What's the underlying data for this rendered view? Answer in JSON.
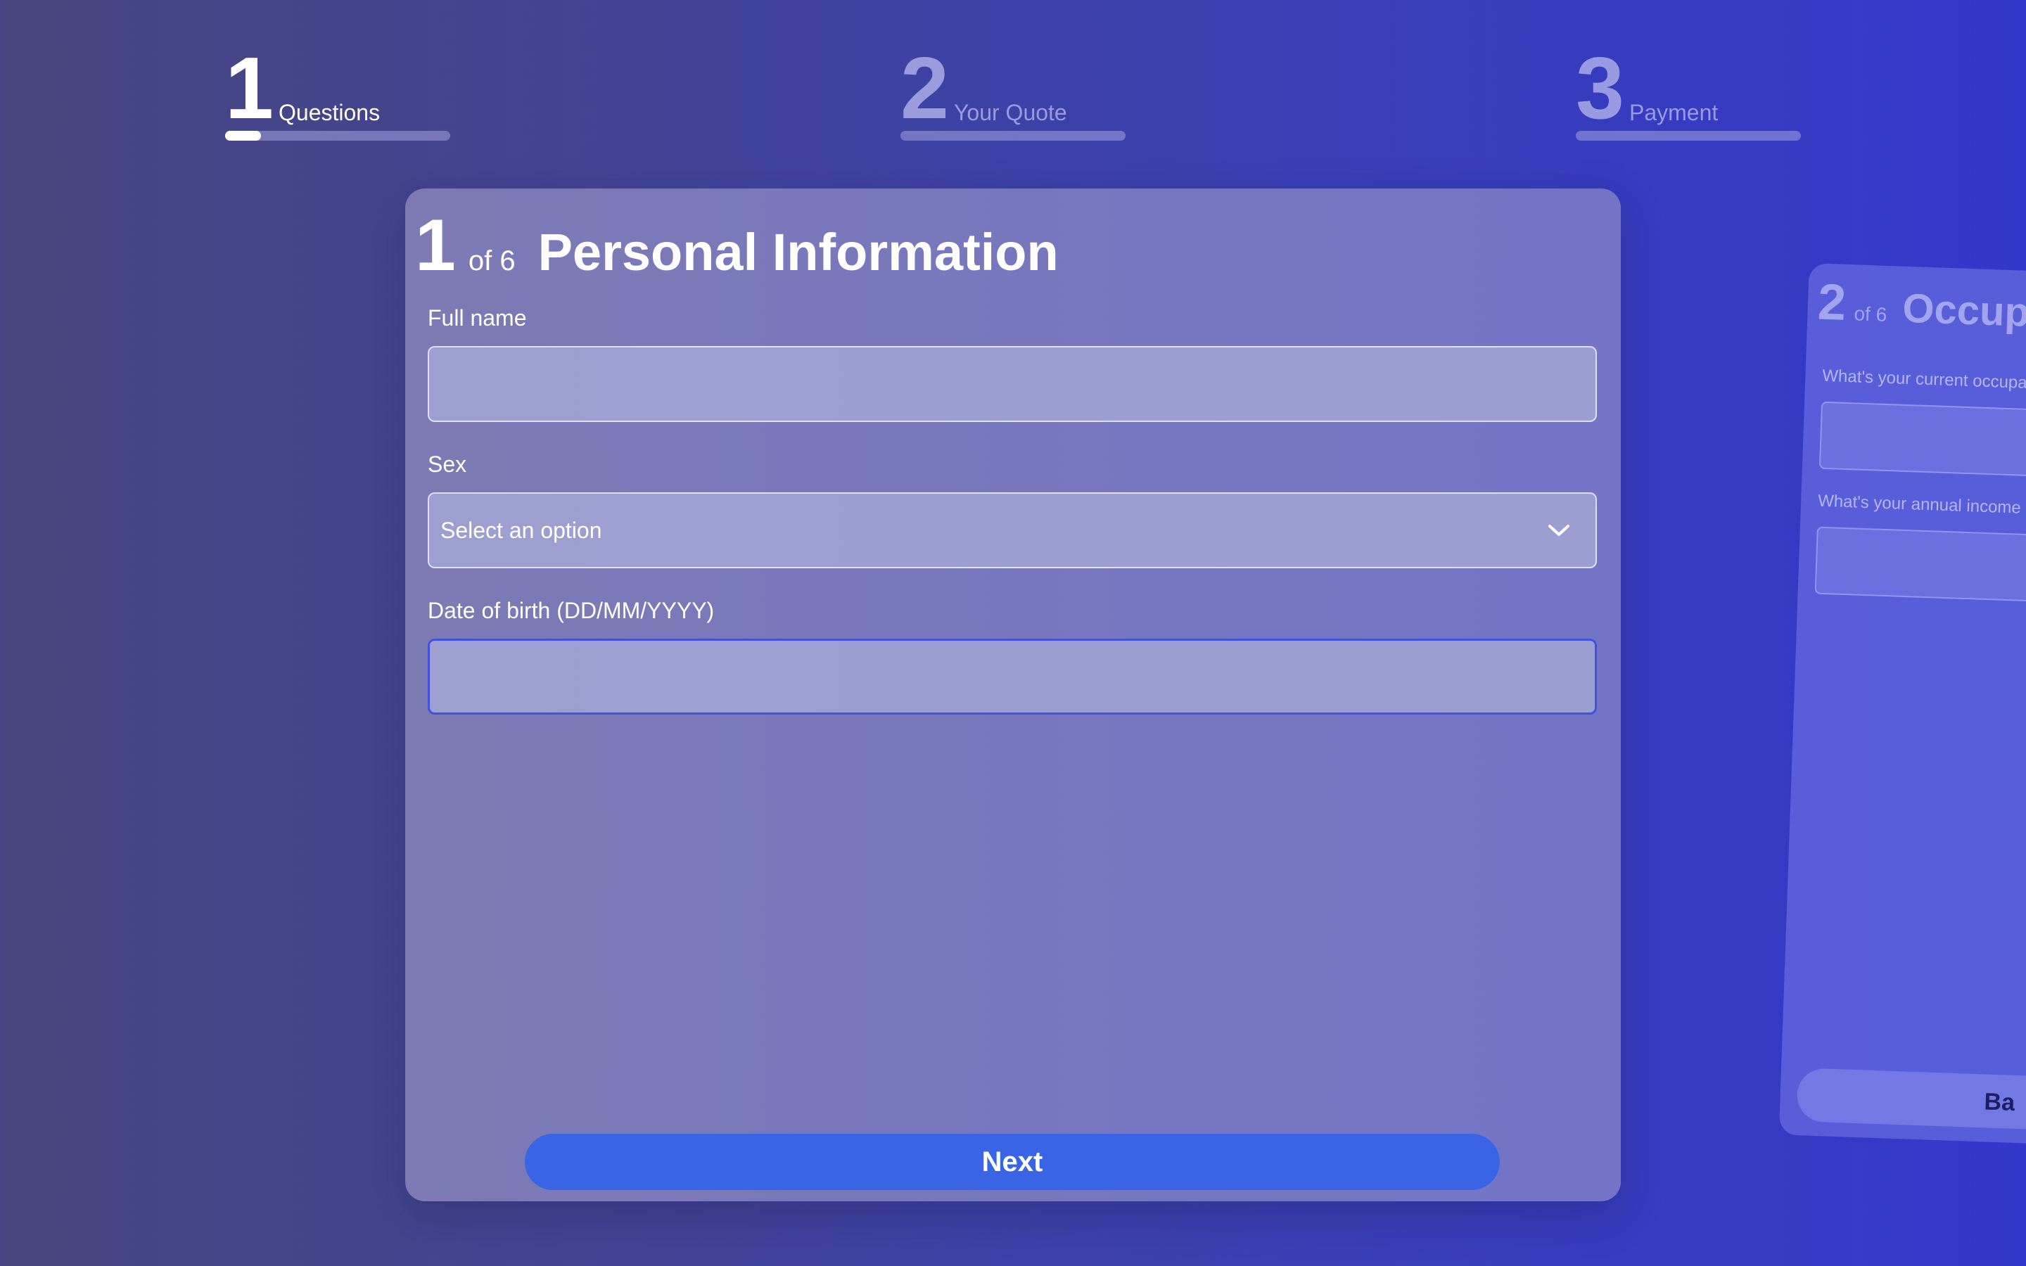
{
  "stepper": {
    "steps": [
      {
        "number": "1",
        "label": "Questions",
        "state": "active",
        "progress": 0.16
      },
      {
        "number": "2",
        "label": "Your Quote",
        "state": "inactive",
        "progress": 0
      },
      {
        "number": "3",
        "label": "Payment",
        "state": "inactive",
        "progress": 0
      }
    ]
  },
  "card": {
    "step_number": "1",
    "step_total": "of 6",
    "title": "Personal Information",
    "fields": {
      "full_name": {
        "label": "Full name",
        "value": ""
      },
      "sex": {
        "label": "Sex",
        "selected": "Select an option"
      },
      "dob": {
        "label": "Date of birth (DD/MM/YYYY)",
        "value": ""
      }
    },
    "next_label": "Next"
  },
  "next_card": {
    "step_number": "2",
    "step_total": "of 6",
    "title": "Occupa",
    "question_1": "What's your current occupa",
    "question_2": "What's your annual income",
    "button_label": "Ba"
  },
  "colors": {
    "accent_button": "#3964e6",
    "focus_border": "#3f52e0",
    "background_left": "#48467f",
    "background_right": "#3338cc"
  }
}
